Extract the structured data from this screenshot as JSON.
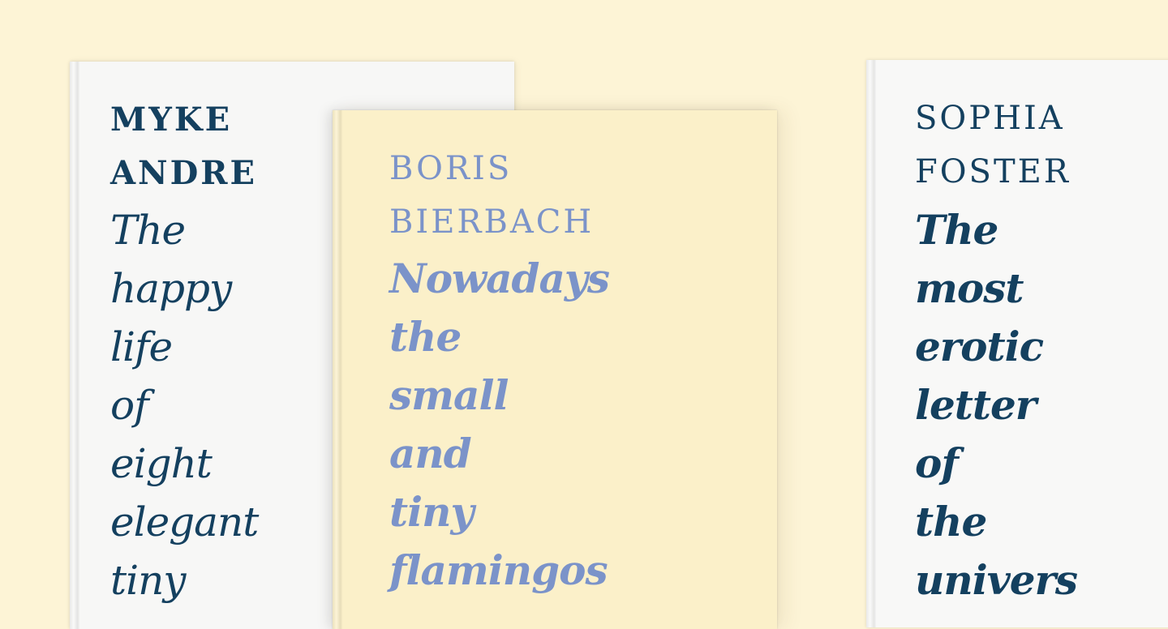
{
  "colors": {
    "background": "#fdf4d6",
    "navy": "#14405f",
    "periwinkle": "#7b93c9",
    "white_cover": "#f7f7f6",
    "cream_cover": "#fbf0c9"
  },
  "books": [
    {
      "author": [
        "MYKE",
        "ANDRE"
      ],
      "title": [
        "The",
        "happy",
        "life",
        "of",
        "eight",
        "elegant",
        "tiny"
      ]
    },
    {
      "author": [
        "BORIS",
        "BIERBACH"
      ],
      "title": [
        "Nowadays",
        "the",
        "small",
        "and",
        "tiny",
        "flamingos"
      ]
    },
    {
      "author": [
        "SOPHIA",
        "FOSTER"
      ],
      "title": [
        "The",
        "most",
        "erotic",
        "letter",
        "of",
        "the",
        "univers"
      ]
    }
  ]
}
